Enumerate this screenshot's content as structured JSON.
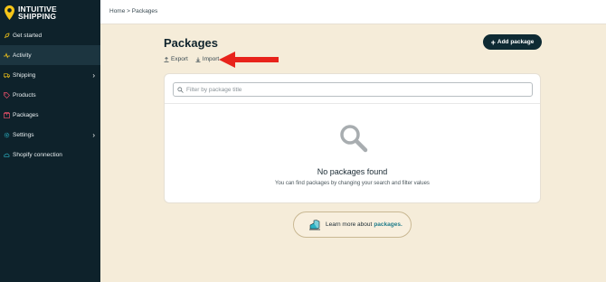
{
  "brand": {
    "line1": "INTUITIVE",
    "line2": "SHIPPING"
  },
  "sidebar": {
    "items": [
      {
        "label": "Get started",
        "icon": "rocket-icon"
      },
      {
        "label": "Activity",
        "icon": "activity-icon",
        "active": true
      },
      {
        "label": "Shipping",
        "icon": "truck-icon",
        "has_submenu": true
      },
      {
        "label": "Products",
        "icon": "tag-icon"
      },
      {
        "label": "Packages",
        "icon": "package-icon"
      },
      {
        "label": "Settings",
        "icon": "gear-icon",
        "has_submenu": true
      },
      {
        "label": "Shopify connection",
        "icon": "cloud-icon"
      }
    ]
  },
  "breadcrumb": "Home > Packages",
  "page": {
    "title": "Packages",
    "add_button": "Add package",
    "export_label": "Export",
    "import_label": "Import"
  },
  "search": {
    "placeholder": "Filter by package title",
    "value": ""
  },
  "empty_state": {
    "title": "No packages found",
    "subtitle": "You can find packages by changing your search and filter values"
  },
  "learn_more": {
    "text": "Learn more about",
    "link": "packages."
  },
  "colors": {
    "sidebar": "#0e222b",
    "accent": "#f5c518",
    "page_bg": "#f5ecd9",
    "arrow": "#e8231b",
    "link": "#1f7c8a"
  }
}
